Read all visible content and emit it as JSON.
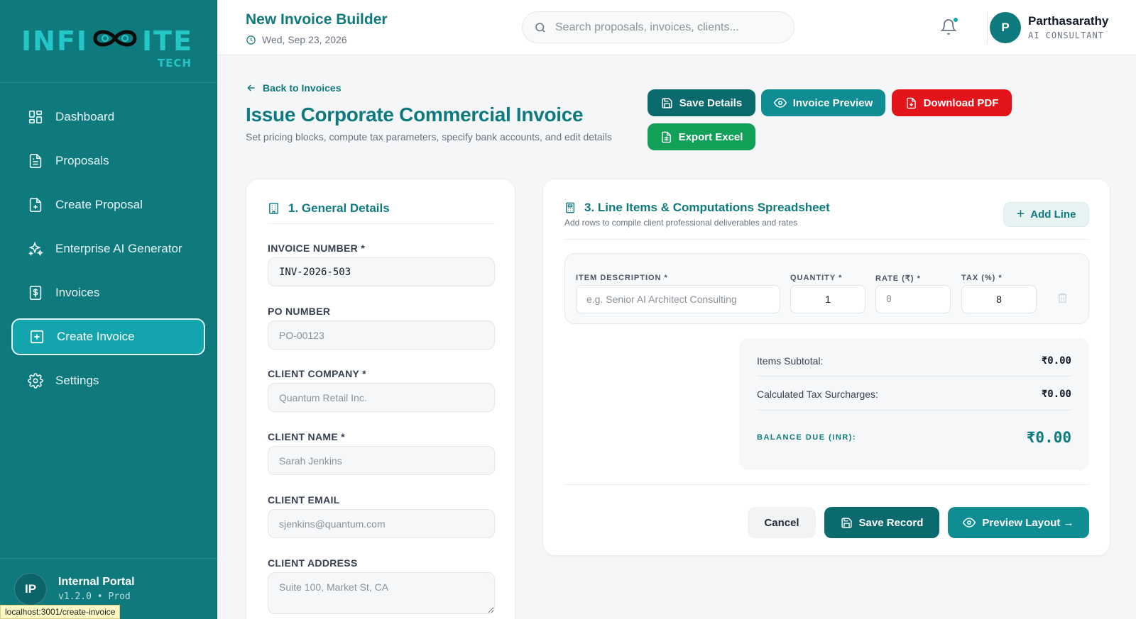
{
  "brand": {
    "logo_left": "INFI",
    "logo_right": "ITE",
    "logo_sub": "TECH",
    "accent": "#0f7a7e",
    "accent_light": "#13a4ad"
  },
  "sidebar": {
    "items": [
      {
        "label": "Dashboard",
        "icon": "dashboard-grid-icon"
      },
      {
        "label": "Proposals",
        "icon": "document-icon"
      },
      {
        "label": "Create Proposal",
        "icon": "document-plus-icon"
      },
      {
        "label": "Enterprise AI Generator",
        "icon": "sparkles-icon"
      },
      {
        "label": "Invoices",
        "icon": "dollar-receipt-icon"
      },
      {
        "label": "Create Invoice",
        "icon": "plus-square-icon",
        "active": true
      },
      {
        "label": "Settings",
        "icon": "gear-icon"
      }
    ],
    "footer": {
      "initials": "IP",
      "title": "Internal Portal",
      "version": "v1.2.0 • Prod"
    }
  },
  "status_url": "localhost:3001/create-invoice",
  "topbar": {
    "title": "New Invoice Builder",
    "date": "Wed, Sep 23, 2026",
    "search_placeholder": "Search proposals, invoices, clients...",
    "user": {
      "initial": "P",
      "name": "Parthasarathy",
      "role": "AI CONSULTANT"
    }
  },
  "header": {
    "back_label": "Back to Invoices",
    "title": "Issue Corporate Commercial Invoice",
    "subtitle": "Set pricing blocks, compute tax parameters, specify bank accounts, and edit details",
    "actions": {
      "save": "Save Details",
      "preview": "Invoice Preview",
      "pdf": "Download PDF",
      "excel": "Export Excel"
    }
  },
  "general": {
    "title": "1. General Details",
    "fields": {
      "invoice_number": {
        "label": "INVOICE NUMBER *",
        "value": "INV-2026-503"
      },
      "po_number": {
        "label": "PO NUMBER",
        "placeholder": "PO-00123"
      },
      "client_company": {
        "label": "CLIENT COMPANY *",
        "placeholder": "Quantum Retail Inc."
      },
      "client_name": {
        "label": "CLIENT NAME *",
        "placeholder": "Sarah Jenkins"
      },
      "client_email": {
        "label": "CLIENT EMAIL",
        "placeholder": "sjenkins@quantum.com"
      },
      "client_address": {
        "label": "CLIENT ADDRESS",
        "placeholder": "Suite 100, Market St, CA"
      }
    }
  },
  "line_items": {
    "title": "3. Line Items & Computations Spreadsheet",
    "subtitle": "Add rows to compile client professional deliverables and rates",
    "add_label": "Add Line",
    "columns": {
      "description": "ITEM DESCRIPTION *",
      "quantity": "QUANTITY *",
      "rate": "RATE (₹) *",
      "tax": "TAX (%) *"
    },
    "rows": [
      {
        "description_placeholder": "e.g. Senior AI Architect Consulting",
        "quantity": "1",
        "rate_placeholder": "0",
        "tax": "8"
      }
    ],
    "totals": {
      "subtotal_label": "Items Subtotal:",
      "subtotal": "₹0.00",
      "tax_label": "Calculated Tax Surcharges:",
      "tax": "₹0.00",
      "balance_label": "BALANCE DUE (INR):",
      "balance": "₹0.00"
    },
    "footer": {
      "cancel": "Cancel",
      "save_record": "Save Record",
      "preview_layout": "Preview Layout →"
    }
  }
}
